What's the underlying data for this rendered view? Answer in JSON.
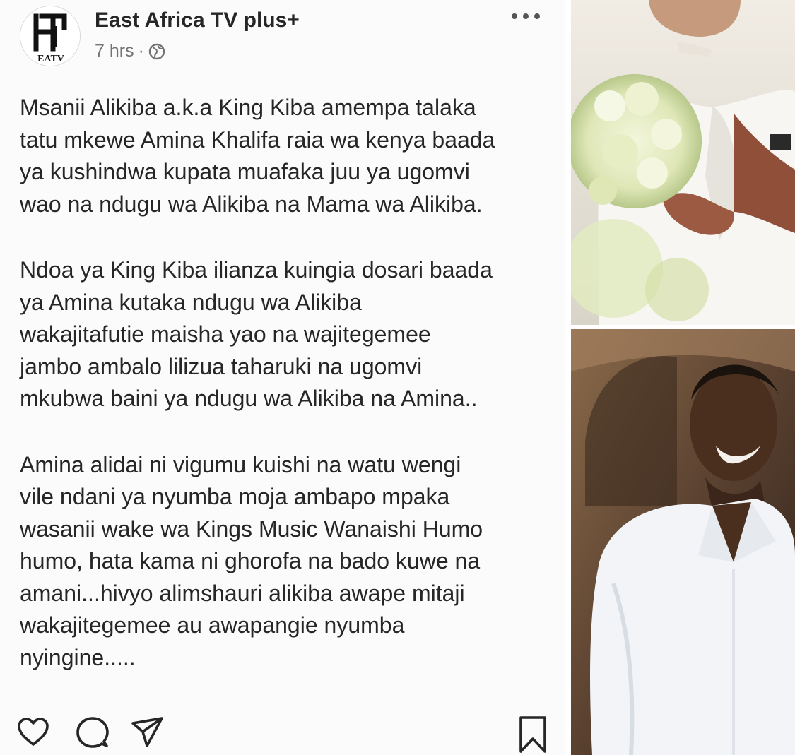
{
  "post": {
    "author": "East Africa TV plus+",
    "time": "7 hrs",
    "separator": "·",
    "avatar_icon": "eatv-logo",
    "avatar_text": "EATV",
    "privacy_icon": "globe-icon",
    "more_icon": "more-options-icon",
    "paragraphs": [
      {
        "lines": [
          "Msanii Alikiba a.k.a King Kiba amempa talaka",
          "tatu mkewe Amina Khalifa raia wa kenya baada",
          "ya kushindwa kupata muafaka juu ya ugomvi",
          "wao na ndugu wa Alikiba na Mama wa Alikiba."
        ]
      },
      {
        "lines": [
          "Ndoa ya King Kiba ilianza kuingia dosari baada",
          "ya Amina kutaka ndugu wa Alikiba",
          "wakajitafutie maisha yao na wajitegemee",
          "jambo ambalo lilizua taharuki na ugomvi",
          "mkubwa baini ya ndugu wa Alikiba na Amina.."
        ]
      },
      {
        "lines": [
          "Amina alidai ni vigumu kuishi na watu wengi",
          "vile ndani ya nyumba moja ambapo mpaka",
          "wasanii wake wa Kings Music Wanaishi Humo",
          "humo, hata kama ni ghorofa na bado kuwe na",
          "amani...hivyo alimshauri alikiba awape mitaji",
          "wakajitegemee au awapangie nyumba",
          "nyingine....."
        ]
      }
    ]
  },
  "actions": {
    "like_icon": "heart-icon",
    "comment_icon": "comment-icon",
    "share_icon": "send-icon",
    "save_icon": "bookmark-icon"
  },
  "photos": [
    {
      "name": "bride-photo"
    },
    {
      "name": "man-photo"
    }
  ],
  "colors": {
    "text": "#262626",
    "muted": "#737373",
    "background": "#fbfbfb"
  }
}
